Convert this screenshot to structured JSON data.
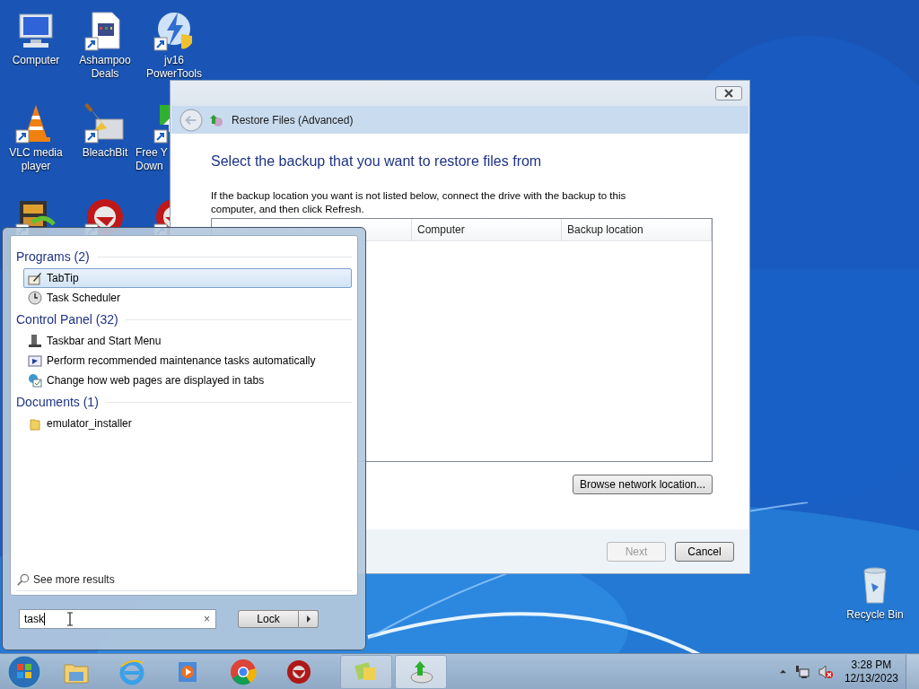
{
  "desktop_icons": [
    {
      "kind": "system",
      "lines": [
        "Computer"
      ]
    },
    {
      "kind": "shortcut",
      "lines": [
        "Ashampoo",
        "Deals"
      ]
    },
    {
      "kind": "shortcut",
      "lines": [
        "jv16",
        "PowerTools"
      ]
    },
    {
      "kind": "shortcut",
      "lines": [
        "VLC media",
        "player"
      ]
    },
    {
      "kind": "shortcut",
      "lines": [
        "BleachBit"
      ]
    },
    {
      "kind": "shortcut",
      "lines": [
        "Free Y",
        "Down"
      ]
    },
    {
      "kind": "shortcut"
    },
    {
      "kind": "shortcut"
    },
    {
      "kind": "shortcut"
    },
    {
      "kind": "system",
      "lines": [
        "Recycle Bin"
      ]
    }
  ],
  "dialog": {
    "title": "Restore Files (Advanced)",
    "heading": "Select the backup that you want to restore files from",
    "description": "If the backup location you want is not listed below, connect the drive with the backup to this computer, and then click Refresh.",
    "columns": [
      "Computer",
      "Backup location"
    ],
    "browse_button": "Browse network location...",
    "buttons": [
      {
        "label": "Next",
        "disabled": true
      },
      {
        "label": "Cancel",
        "disabled": false
      }
    ]
  },
  "start_menu": {
    "groups": [
      {
        "title": "Programs (2)",
        "items": [
          {
            "label": "TabTip",
            "selected": true
          },
          {
            "label": "Task Scheduler",
            "selected": false
          }
        ]
      },
      {
        "title": "Control Panel (32)",
        "items": [
          {
            "label": "Taskbar and Start Menu",
            "selected": false
          },
          {
            "label": "Perform recommended maintenance tasks automatically",
            "selected": false
          },
          {
            "label": "Change how web pages are displayed in tabs",
            "selected": false
          }
        ]
      },
      {
        "title": "Documents (1)",
        "items": [
          {
            "label": "emulator_installer",
            "selected": false
          }
        ]
      }
    ],
    "see_more": "See more results",
    "search": {
      "value": "task",
      "clear": "×"
    },
    "lock_button": "Lock"
  },
  "taskbar": {
    "time": "3:28 PM",
    "date": "12/13/2023"
  }
}
